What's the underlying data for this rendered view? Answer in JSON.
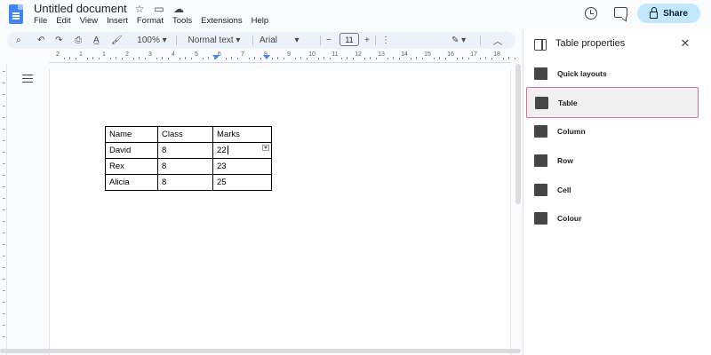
{
  "app": {
    "doc_title": "Untitled document",
    "menu": [
      "File",
      "Edit",
      "View",
      "Insert",
      "Format",
      "Tools",
      "Extensions",
      "Help"
    ],
    "share_label": "Share"
  },
  "toolbar": {
    "zoom": "100%",
    "style": "Normal text",
    "font": "Arial",
    "font_size": "11"
  },
  "ruler": {
    "numbers": [
      "2",
      "1",
      "1",
      "2",
      "3",
      "4",
      "5",
      "6",
      "7",
      "8",
      "9",
      "10",
      "11",
      "12",
      "13",
      "14",
      "15",
      "16",
      "17",
      "18"
    ]
  },
  "table": {
    "rows": [
      [
        "Name",
        "Class",
        "Marks"
      ],
      [
        "David",
        "8",
        "22"
      ],
      [
        "Rex",
        "8",
        "23"
      ],
      [
        "Alicia",
        "8",
        "25"
      ]
    ]
  },
  "panel": {
    "title": "Table properties",
    "sections": [
      {
        "label": "Quick layouts",
        "active": false
      },
      {
        "label": "Table",
        "active": true
      },
      {
        "label": "Column",
        "active": false
      },
      {
        "label": "Row",
        "active": false
      },
      {
        "label": "Cell",
        "active": false
      },
      {
        "label": "Colour",
        "active": false
      }
    ]
  },
  "colors": {
    "accent": "#4285f4",
    "share_bg": "#c2e7ff",
    "active_border": "#dd6f95"
  }
}
